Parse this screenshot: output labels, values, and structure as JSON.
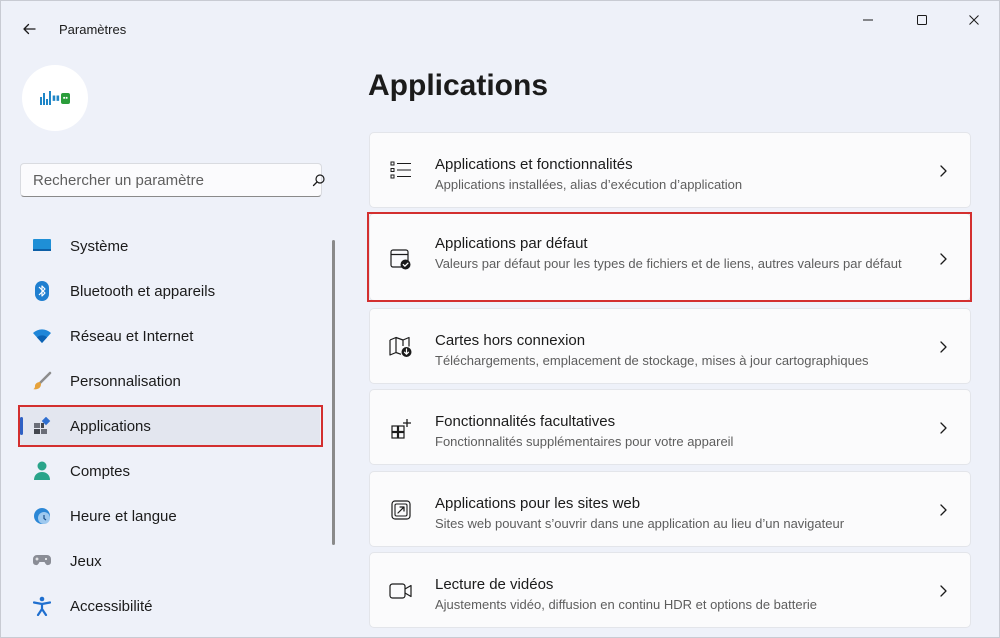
{
  "window": {
    "title": "Paramètres"
  },
  "sidebar": {
    "search_placeholder": "Rechercher un paramètre",
    "items": [
      {
        "label": "Système",
        "icon": "monitor-icon",
        "active": false
      },
      {
        "label": "Bluetooth et appareils",
        "icon": "bluetooth-icon",
        "active": false
      },
      {
        "label": "Réseau et Internet",
        "icon": "wifi-icon",
        "active": false
      },
      {
        "label": "Personnalisation",
        "icon": "brush-icon",
        "active": false
      },
      {
        "label": "Applications",
        "icon": "apps-icon",
        "active": true
      },
      {
        "label": "Comptes",
        "icon": "person-icon",
        "active": false
      },
      {
        "label": "Heure et langue",
        "icon": "clock-globe-icon",
        "active": false
      },
      {
        "label": "Jeux",
        "icon": "gamepad-icon",
        "active": false
      },
      {
        "label": "Accessibilité",
        "icon": "accessibility-icon",
        "active": false
      }
    ]
  },
  "main": {
    "title": "Applications",
    "cards": [
      {
        "title": "Applications et fonctionnalités",
        "subtitle": "Applications installées, alias d’exécution d’application",
        "icon": "list-icon"
      },
      {
        "title": "Applications par défaut",
        "subtitle": "Valeurs par défaut pour les types de fichiers et de liens, autres valeurs par défaut",
        "icon": "default-apps-icon"
      },
      {
        "title": "Cartes hors connexion",
        "subtitle": "Téléchargements, emplacement de stockage, mises à jour cartographiques",
        "icon": "map-download-icon"
      },
      {
        "title": "Fonctionnalités facultatives",
        "subtitle": "Fonctionnalités supplémentaires pour votre appareil",
        "icon": "add-feature-icon"
      },
      {
        "title": "Applications pour les sites web",
        "subtitle": "Sites web pouvant s’ouvrir dans une application au lieu d’un navigateur",
        "icon": "open-in-app-icon"
      },
      {
        "title": "Lecture de vidéos",
        "subtitle": "Ajustements vidéo, diffusion en continu HDR et options de batterie",
        "icon": "video-icon"
      }
    ]
  },
  "colors": {
    "accent": "#2f60c4",
    "highlight_border": "#d32f2f",
    "background": "#eef1f9",
    "card_background": "#fbfbfc"
  }
}
